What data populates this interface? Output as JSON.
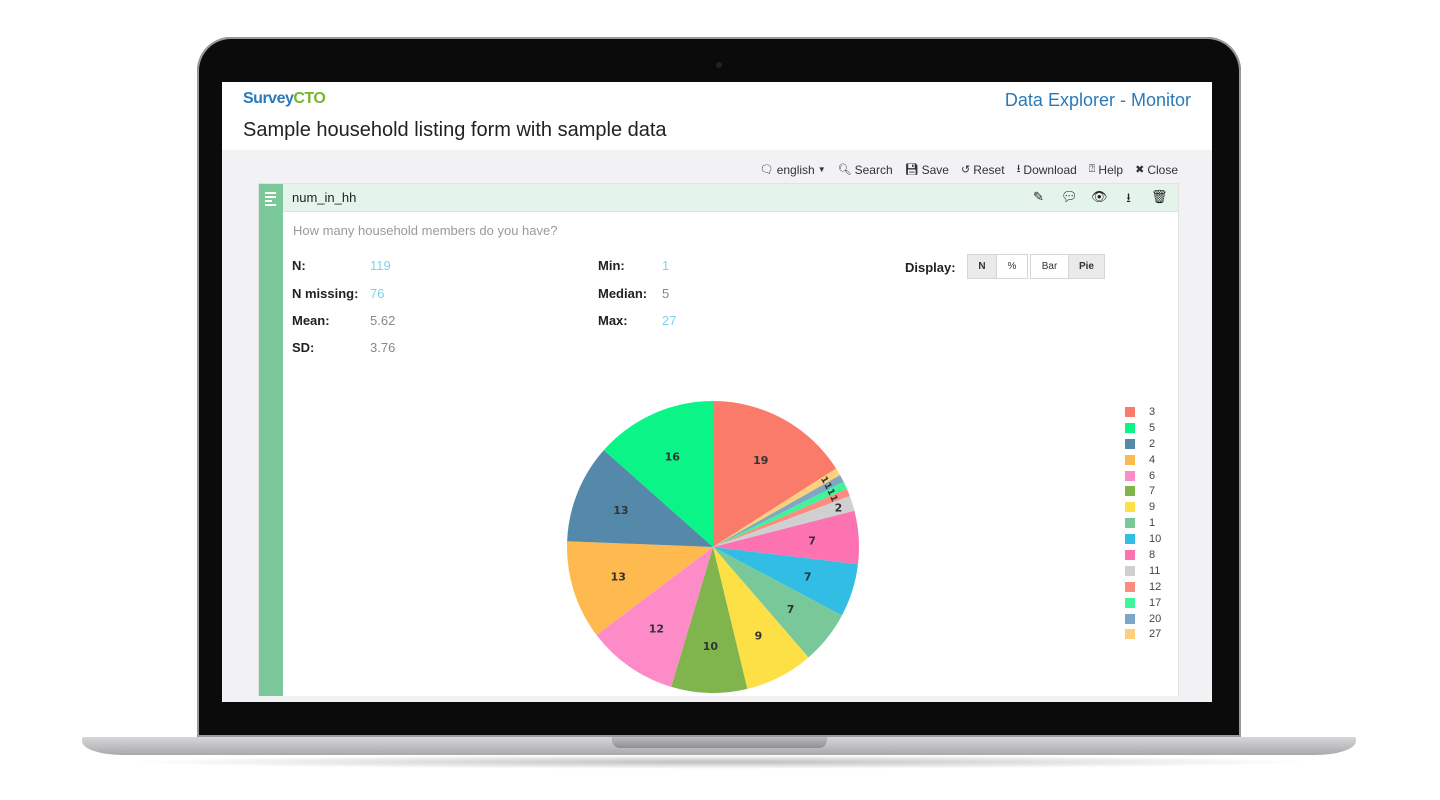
{
  "header": {
    "logo_part1": "Survey",
    "logo_part2": "CTO",
    "app_title": "Data Explorer - Monitor",
    "form_title": "Sample household listing form with sample data"
  },
  "toolbar": {
    "language": "english",
    "search": "Search",
    "save": "Save",
    "reset": "Reset",
    "download": "Download",
    "help": "Help",
    "close": "Close"
  },
  "field": {
    "name": "num_in_hh",
    "question": "How many household members do you have?"
  },
  "stats": {
    "n_label": "N:",
    "n_value": "119",
    "n_missing_label": "N missing:",
    "n_missing_value": "76",
    "mean_label": "Mean:",
    "mean_value": "5.62",
    "sd_label": "SD:",
    "sd_value": "3.76",
    "min_label": "Min:",
    "min_value": "1",
    "median_label": "Median:",
    "median_value": "5",
    "max_label": "Max:",
    "max_value": "27"
  },
  "display": {
    "label": "Display:",
    "n_btn": "N",
    "pct_btn": "%",
    "bar_btn": "Bar",
    "pie_btn": "Pie",
    "active_count_mode": "N",
    "active_chart": "Pie"
  },
  "colors": {
    "link_value": "#7fd3e8",
    "plain_value": "#888888",
    "accent_green": "#7bc99a",
    "brand_blue": "#2a7ab8"
  },
  "chart_data": {
    "type": "pie",
    "title": "",
    "direction": "clockwise",
    "start": "top",
    "slices": [
      {
        "label": "3",
        "value": 19,
        "color": "#fa7b6a"
      },
      {
        "label": "27",
        "value": 1,
        "color": "#fcd07c"
      },
      {
        "label": "20",
        "value": 1,
        "color": "#7fa6c4"
      },
      {
        "label": "17",
        "value": 1,
        "color": "#3df59a"
      },
      {
        "label": "12",
        "value": 1,
        "color": "#fd8b80"
      },
      {
        "label": "11",
        "value": 2,
        "color": "#d0d0d0"
      },
      {
        "label": "8",
        "value": 7,
        "color": "#fd72b1"
      },
      {
        "label": "10",
        "value": 7,
        "color": "#32bee4"
      },
      {
        "label": "1",
        "value": 7,
        "color": "#78c89a"
      },
      {
        "label": "9",
        "value": 9,
        "color": "#fde046"
      },
      {
        "label": "7",
        "value": 10,
        "color": "#80b54e"
      },
      {
        "label": "6",
        "value": 12,
        "color": "#fd8bc8"
      },
      {
        "label": "4",
        "value": 13,
        "color": "#feb94f"
      },
      {
        "label": "2",
        "value": 13,
        "color": "#5589aa"
      },
      {
        "label": "5",
        "value": 16,
        "color": "#0af487"
      }
    ],
    "legend_order": [
      "3",
      "5",
      "2",
      "4",
      "6",
      "7",
      "9",
      "1",
      "10",
      "8",
      "11",
      "12",
      "17",
      "20",
      "27"
    ],
    "legend_position": "right"
  }
}
